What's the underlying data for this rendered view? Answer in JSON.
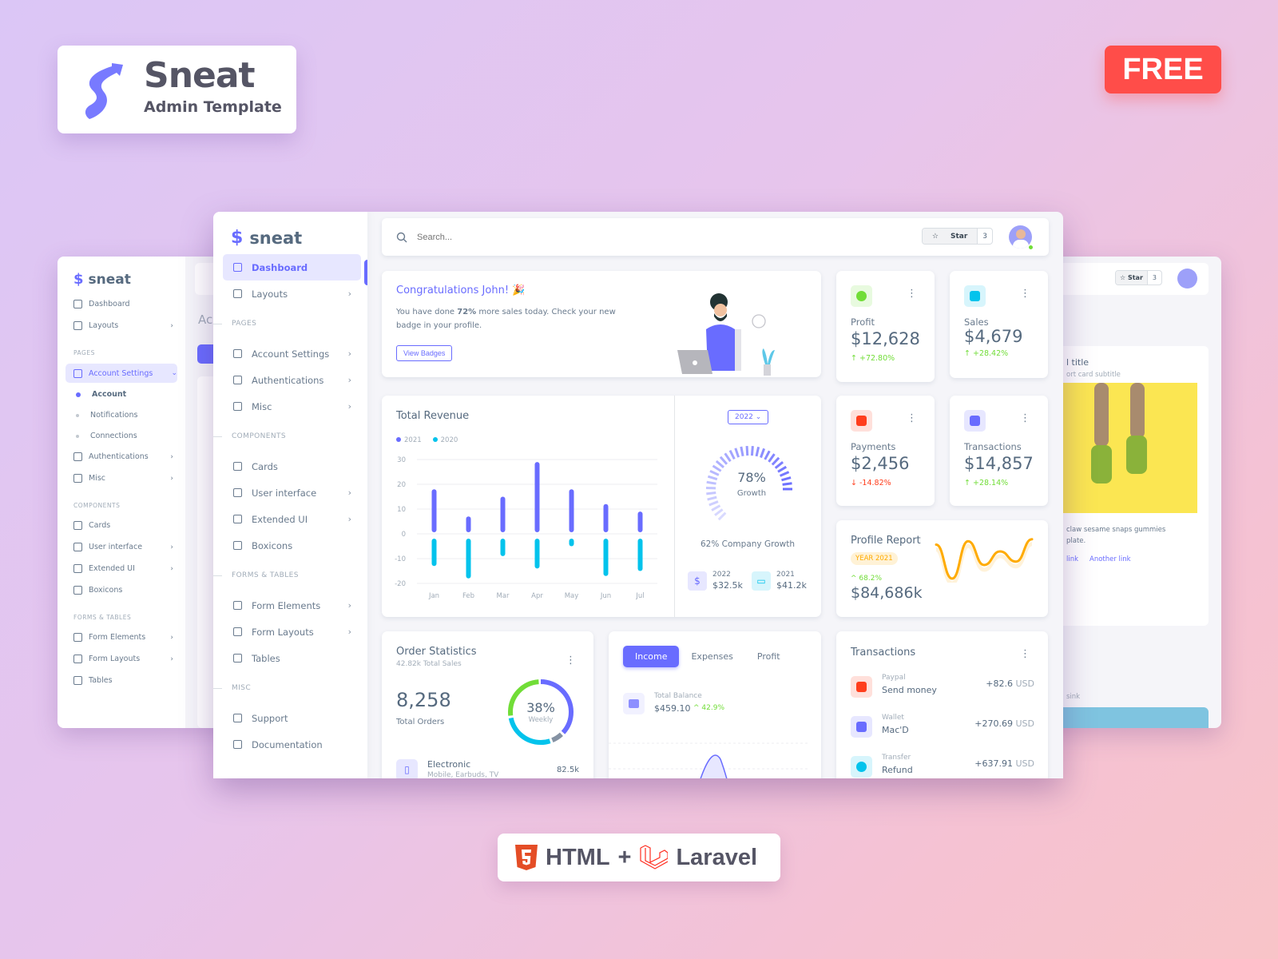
{
  "branding": {
    "title": "Sneat",
    "subtitle": "Admin Template",
    "free_badge": "FREE",
    "stack": {
      "html": "HTML",
      "plus": "+",
      "laravel": "Laravel"
    }
  },
  "colors": {
    "primary": "#696cff",
    "success": "#71dd37",
    "danger": "#ff3e1d",
    "info": "#03c3ec",
    "warning": "#ffab00"
  },
  "back_left": {
    "logo": "sneat",
    "items": [
      {
        "type": "item",
        "label": "Dashboard",
        "icon": "home-icon"
      },
      {
        "type": "item",
        "label": "Layouts",
        "icon": "layout-icon",
        "chevron": true
      },
      {
        "type": "head",
        "label": "PAGES"
      },
      {
        "type": "item",
        "label": "Account Settings",
        "icon": "dock-icon",
        "chevron": true,
        "active": true
      },
      {
        "type": "sub",
        "label": "Account",
        "active": true
      },
      {
        "type": "sub",
        "label": "Notifications"
      },
      {
        "type": "sub",
        "label": "Connections"
      },
      {
        "type": "item",
        "label": "Authentications",
        "icon": "lock-icon",
        "chevron": true
      },
      {
        "type": "item",
        "label": "Misc",
        "icon": "cube-icon",
        "chevron": true
      },
      {
        "type": "head",
        "label": "COMPONENTS"
      },
      {
        "type": "item",
        "label": "Cards",
        "icon": "collection-icon"
      },
      {
        "type": "item",
        "label": "User interface",
        "icon": "box-icon",
        "chevron": true
      },
      {
        "type": "item",
        "label": "Extended UI",
        "icon": "copy-icon",
        "chevron": true
      },
      {
        "type": "item",
        "label": "Boxicons",
        "icon": "crown-icon"
      },
      {
        "type": "head",
        "label": "FORMS & TABLES"
      },
      {
        "type": "item",
        "label": "Form Elements",
        "icon": "detail-icon",
        "chevron": true
      },
      {
        "type": "item",
        "label": "Form Layouts",
        "icon": "detail-icon",
        "chevron": true
      },
      {
        "type": "item",
        "label": "Tables",
        "icon": "table-icon"
      }
    ],
    "page_title_fragment": "Acc"
  },
  "back_right": {
    "star_label": "Star",
    "star_count": "3",
    "card_title_fragment": "l title",
    "card_subtitle_fragment": "ort card subtitle",
    "text_line1": "claw sesame snaps gummies",
    "text_line2": "plate.",
    "link1_fragment": "link",
    "link2": "Another link",
    "bottom_fragment": "sink"
  },
  "sidebar": {
    "logo": "sneat",
    "items": [
      {
        "type": "item",
        "label": "Dashboard",
        "icon": "home-icon",
        "active": true
      },
      {
        "type": "item",
        "label": "Layouts",
        "icon": "layout-icon",
        "chevron": true
      },
      {
        "type": "head",
        "label": "PAGES"
      },
      {
        "type": "item",
        "label": "Account Settings",
        "icon": "dock-icon",
        "chevron": true
      },
      {
        "type": "item",
        "label": "Authentications",
        "icon": "lock-icon",
        "chevron": true
      },
      {
        "type": "item",
        "label": "Misc",
        "icon": "cube-icon",
        "chevron": true
      },
      {
        "type": "head",
        "label": "COMPONENTS"
      },
      {
        "type": "item",
        "label": "Cards",
        "icon": "collection-icon"
      },
      {
        "type": "item",
        "label": "User interface",
        "icon": "box-icon",
        "chevron": true
      },
      {
        "type": "item",
        "label": "Extended UI",
        "icon": "copy-icon",
        "chevron": true
      },
      {
        "type": "item",
        "label": "Boxicons",
        "icon": "crown-icon"
      },
      {
        "type": "head",
        "label": "FORMS & TABLES"
      },
      {
        "type": "item",
        "label": "Form Elements",
        "icon": "detail-icon",
        "chevron": true
      },
      {
        "type": "item",
        "label": "Form Layouts",
        "icon": "detail-icon",
        "chevron": true
      },
      {
        "type": "item",
        "label": "Tables",
        "icon": "table-icon"
      },
      {
        "type": "head",
        "label": "MISC"
      },
      {
        "type": "item",
        "label": "Support",
        "icon": "support-icon"
      },
      {
        "type": "item",
        "label": "Documentation",
        "icon": "file-icon"
      }
    ]
  },
  "topbar": {
    "search_placeholder": "Search...",
    "star_label": "Star",
    "star_count": "3"
  },
  "congrats": {
    "title": "Congratulations John! 🎉",
    "text_pre": "You have done ",
    "text_bold": "72%",
    "text_post": " more sales today. Check your new badge in your profile.",
    "button": "View Badges"
  },
  "stats": [
    {
      "label": "Profit",
      "value": "$12,628",
      "change": "+72.80%",
      "dir": "up",
      "icon": "pie-chart-icon",
      "color": "#71dd37",
      "bg": "#e8fadf"
    },
    {
      "label": "Sales",
      "value": "$4,679",
      "change": "+28.42%",
      "dir": "up",
      "icon": "wallet-icon",
      "color": "#03c3ec",
      "bg": "#d7f5fc"
    },
    {
      "label": "Payments",
      "value": "$2,456",
      "change": "-14.82%",
      "dir": "down",
      "icon": "paypal-icon",
      "color": "#ff3e1d",
      "bg": "#ffe0db"
    },
    {
      "label": "Transactions",
      "value": "$14,857",
      "change": "+28.14%",
      "dir": "up",
      "icon": "credit-card-icon",
      "color": "#696cff",
      "bg": "#e7e7ff"
    }
  ],
  "revenue": {
    "title": "Total Revenue",
    "year_select": "2022",
    "growth_pct": 78,
    "growth_value": "78%",
    "growth_label": "Growth",
    "company_growth": "62% Company Growth",
    "summary": [
      {
        "year": "2022",
        "value": "$32.5k",
        "icon": "dollar-icon"
      },
      {
        "year": "2021",
        "value": "$41.2k",
        "icon": "wallet-icon"
      }
    ]
  },
  "chart_data": {
    "type": "bar",
    "categories": [
      "Jan",
      "Feb",
      "Mar",
      "Apr",
      "May",
      "Jun",
      "Jul"
    ],
    "series": [
      {
        "name": "2021",
        "values": [
          18,
          7,
          15,
          29,
          18,
          12,
          9
        ],
        "color": "#696cff"
      },
      {
        "name": "2020",
        "values": [
          -13,
          -18,
          -9,
          -14,
          -5,
          -17,
          -15
        ],
        "color": "#03c3ec"
      }
    ],
    "yticks": [
      30,
      20,
      10,
      0,
      -10,
      -20
    ],
    "ylim": [
      -20,
      30
    ],
    "grid": true,
    "legend": "top-left"
  },
  "profile_report": {
    "title": "Profile Report",
    "badge": "YEAR 2021",
    "change": "68.2%",
    "value": "$84,686k",
    "line": [
      10,
      60,
      5,
      40,
      20,
      35,
      2
    ]
  },
  "order_stats": {
    "title": "Order Statistics",
    "subtitle": "42.82k Total Sales",
    "total": "8,258",
    "total_label": "Total Orders",
    "donut_pct": "38%",
    "donut_label": "Weekly",
    "donut": [
      {
        "value": 38,
        "color": "#696cff"
      },
      {
        "value": 7,
        "color": "#8592a3"
      },
      {
        "value": 28,
        "color": "#03c3ec"
      },
      {
        "value": 27,
        "color": "#71dd37"
      }
    ],
    "items": [
      {
        "name": "Electronic",
        "sub": "Mobile, Earbuds, TV",
        "value": "82.5k"
      }
    ]
  },
  "income": {
    "tabs": [
      "Income",
      "Expenses",
      "Profit"
    ],
    "active_tab": "Income",
    "balance_label": "Total Balance",
    "balance": "$459.10",
    "balance_change": "42.9%"
  },
  "transactions": {
    "title": "Transactions",
    "rows": [
      {
        "kind": "Paypal",
        "desc": "Send money",
        "amount": "+82.6",
        "cur": "USD",
        "icon": "paypal-icon",
        "bg": "#ffe0db",
        "color": "#ff3e1d"
      },
      {
        "kind": "Wallet",
        "desc": "Mac'D",
        "amount": "+270.69",
        "cur": "USD",
        "icon": "wallet-icon",
        "bg": "#e7e7ff",
        "color": "#696cff"
      },
      {
        "kind": "Transfer",
        "desc": "Refund",
        "amount": "+637.91",
        "cur": "USD",
        "icon": "pie-chart-icon",
        "bg": "#d7f5fc",
        "color": "#03c3ec"
      }
    ]
  }
}
